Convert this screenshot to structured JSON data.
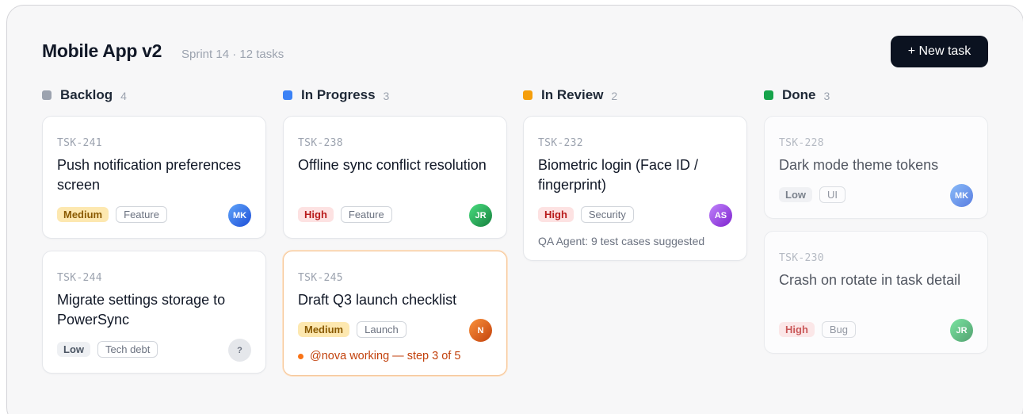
{
  "header": {
    "title": "Mobile App v2",
    "subtitle": "Sprint 14 · 12 tasks",
    "new_task_label": "+ New task"
  },
  "colors": {
    "backlog": "#9ca3af",
    "in_progress": "#3b82f6",
    "in_review": "#f59e0b",
    "done": "#16a34a",
    "button": "#0b1220"
  },
  "columns": [
    {
      "name": "Backlog",
      "count": "4",
      "cards": [
        {
          "id": "TSK-241",
          "title": "Push notification preferences screen",
          "priority": "Medium",
          "tag": "Feature",
          "assignee": "MK"
        },
        {
          "id": "TSK-244",
          "title": "Migrate settings storage to PowerSync",
          "priority": "Low",
          "tag": "Tech debt",
          "assignee": "?"
        }
      ]
    },
    {
      "name": "In Progress",
      "count": "3",
      "cards": [
        {
          "id": "TSK-238",
          "title": "Offline sync conflict resolution",
          "priority": "High",
          "tag": "Feature",
          "assignee": "JR"
        },
        {
          "id": "TSK-245",
          "title": "Draft Q3 launch checklist",
          "priority": "Medium",
          "tag": "Launch",
          "assignee": "N",
          "agent_status": "@nova working — step 3 of 5"
        }
      ]
    },
    {
      "name": "In Review",
      "count": "2",
      "cards": [
        {
          "id": "TSK-232",
          "title": "Biometric login (Face ID / fingerprint)",
          "priority": "High",
          "tag": "Security",
          "assignee": "AS",
          "note": "QA Agent: 9 test cases suggested"
        }
      ]
    },
    {
      "name": "Done",
      "count": "3",
      "cards": [
        {
          "id": "TSK-228",
          "title": "Dark mode theme tokens",
          "priority": "Low",
          "tag": "UI",
          "assignee": "MK"
        },
        {
          "id": "TSK-230",
          "title": "Crash on rotate in task detail",
          "priority": "High",
          "tag": "Bug",
          "assignee": "JR"
        }
      ]
    }
  ]
}
